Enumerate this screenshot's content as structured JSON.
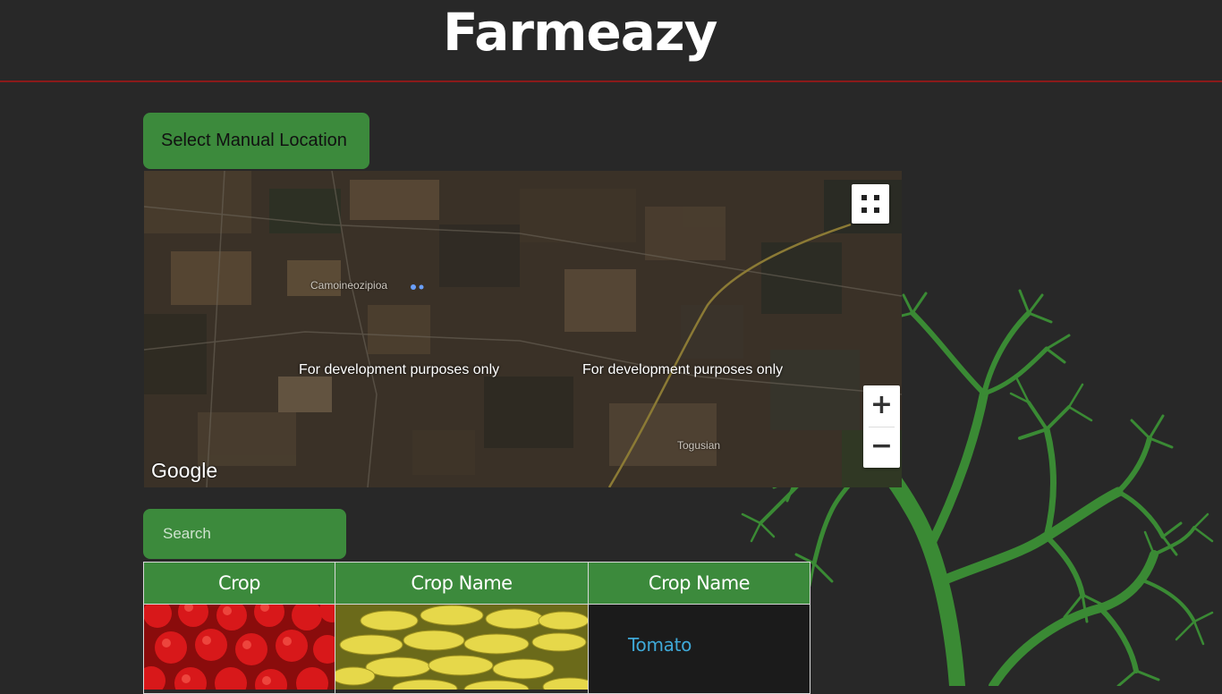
{
  "header": {
    "title": "Farmeazy"
  },
  "location_button": {
    "label": "Select Manual Location"
  },
  "map": {
    "place_labels": [
      "Camoineozipioa",
      "Togusian"
    ],
    "watermark_text": "For development purposes only",
    "logo_text": "Google",
    "zoom_in": "+",
    "zoom_out": "−"
  },
  "search": {
    "placeholder": "Search",
    "value": ""
  },
  "table": {
    "headers": [
      "Crop",
      "Crop Name",
      "Crop Name"
    ],
    "rows": [
      {
        "image_1": "tomatoes",
        "image_2": "bananas",
        "name": "Tomato"
      }
    ]
  },
  "colors": {
    "background": "#282828",
    "accent_green": "#3c8a3c",
    "header_rule": "#8b1a1a",
    "link": "#3fa9d8"
  }
}
